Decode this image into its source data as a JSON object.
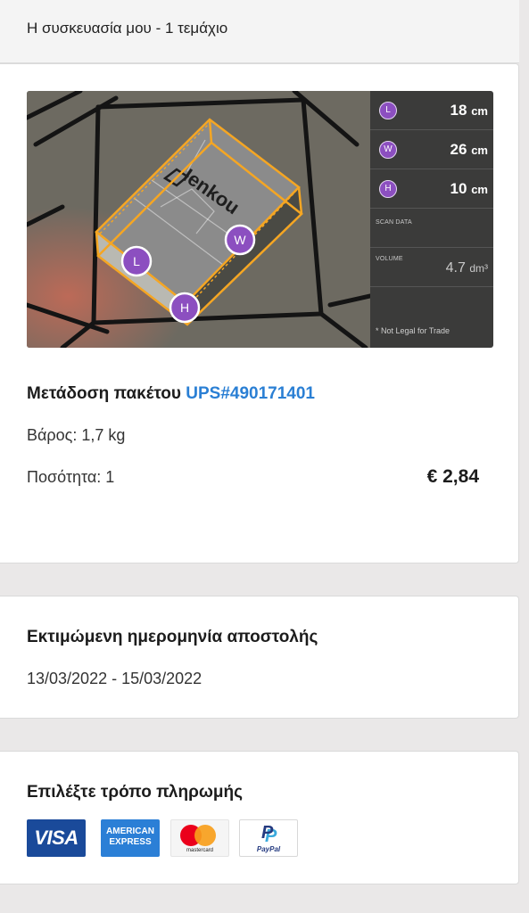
{
  "header": {
    "title": "Η συσκευασία μου - 1 τεμάχιο"
  },
  "scan": {
    "dimensions": [
      {
        "badge": "L",
        "value": "18",
        "unit": "cm"
      },
      {
        "badge": "W",
        "value": "26",
        "unit": "cm"
      },
      {
        "badge": "H",
        "value": "10",
        "unit": "cm"
      }
    ],
    "scan_data_label": "SCAN DATA",
    "volume_label": "VOLUME",
    "volume_value": "4.7",
    "volume_unit": "dm³",
    "legal_note": "* Not Legal for Trade",
    "brand_marking": "Ienkou",
    "badge_color": "#8c4fc0",
    "box_outline_color": "#f5a623"
  },
  "package": {
    "shipment_label": "Μετάδοση πακέτου",
    "tracking": "UPS#490171401",
    "weight": "Βάρος: 1,7 kg",
    "quantity": "Ποσότητα: 1",
    "price": "€ 2,84"
  },
  "estimate": {
    "title": "Εκτιμώμενη ημερομηνία αποστολής",
    "dates": "13/03/2022 - 15/03/2022"
  },
  "payment": {
    "title": "Επιλέξτε τρόπο πληρωμής",
    "methods": {
      "visa": "VISA",
      "amex_line1": "AMERICAN",
      "amex_line2": "EXPRESS",
      "mastercard": "mastercard",
      "paypal": "PayPal"
    }
  },
  "colors": {
    "accent": "#2a7fd4",
    "background": "#eae8e8"
  }
}
